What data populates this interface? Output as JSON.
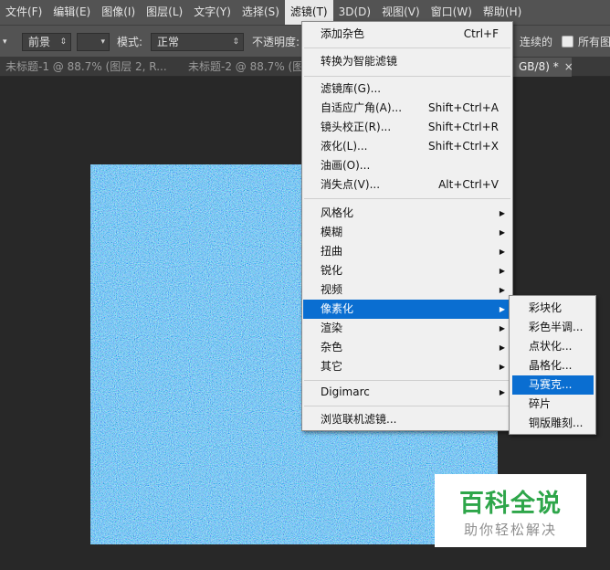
{
  "menubar": {
    "items": [
      "文件(F)",
      "编辑(E)",
      "图像(I)",
      "图层(L)",
      "文字(Y)",
      "选择(S)",
      "滤镜(T)",
      "3D(D)",
      "视图(V)",
      "窗口(W)",
      "帮助(H)"
    ],
    "active_index": 6
  },
  "options": {
    "tool_arrow": "▾",
    "foreground_value": "前景",
    "mode_label": "模式:",
    "mode_value": "正常",
    "opacity_label": "不透明度:",
    "contiguous_label": "连续的",
    "all_layers_label": "所有图"
  },
  "tabs": [
    {
      "label": "未标题-1 @ 88.7% (图层 2, R..."
    },
    {
      "label": "未标题-2 @ 88.7% (图"
    },
    {
      "label": "GB/8) *",
      "close": "×"
    }
  ],
  "filter_menu": {
    "add_noise": {
      "label": "添加杂色",
      "shortcut": "Ctrl+F"
    },
    "convert_smart": {
      "label": "转换为智能滤镜"
    },
    "gallery": {
      "label": "滤镜库(G)..."
    },
    "adaptive_wide": {
      "label": "自适应广角(A)...",
      "shortcut": "Shift+Ctrl+A"
    },
    "lens_correction": {
      "label": "镜头校正(R)...",
      "shortcut": "Shift+Ctrl+R"
    },
    "liquify": {
      "label": "液化(L)...",
      "shortcut": "Shift+Ctrl+X"
    },
    "oil_paint": {
      "label": "油画(O)..."
    },
    "vanishing_point": {
      "label": "消失点(V)...",
      "shortcut": "Alt+Ctrl+V"
    },
    "stylize": {
      "label": "风格化"
    },
    "blur": {
      "label": "模糊"
    },
    "distort": {
      "label": "扭曲"
    },
    "sharpen": {
      "label": "锐化"
    },
    "video": {
      "label": "视频"
    },
    "pixelate": {
      "label": "像素化"
    },
    "render": {
      "label": "渲染"
    },
    "noise": {
      "label": "杂色"
    },
    "other": {
      "label": "其它"
    },
    "digimarc": {
      "label": "Digimarc"
    },
    "browse_online": {
      "label": "浏览联机滤镜..."
    },
    "submenu_arrow": "▶"
  },
  "pixelate_submenu": {
    "items": [
      "彩块化",
      "彩色半调...",
      "点状化...",
      "晶格化...",
      "马赛克...",
      "碎片",
      "铜版雕刻..."
    ],
    "highlighted_index": 4
  },
  "watermark": {
    "title": "百科全说",
    "subtitle": "助你轻松解决"
  },
  "colors": {
    "menubar_bg": "#535353",
    "workspace_bg": "#282828",
    "highlight": "#0a6ed1",
    "noise_base": "#3aa8c8",
    "watermark_green": "#2ea64a"
  }
}
